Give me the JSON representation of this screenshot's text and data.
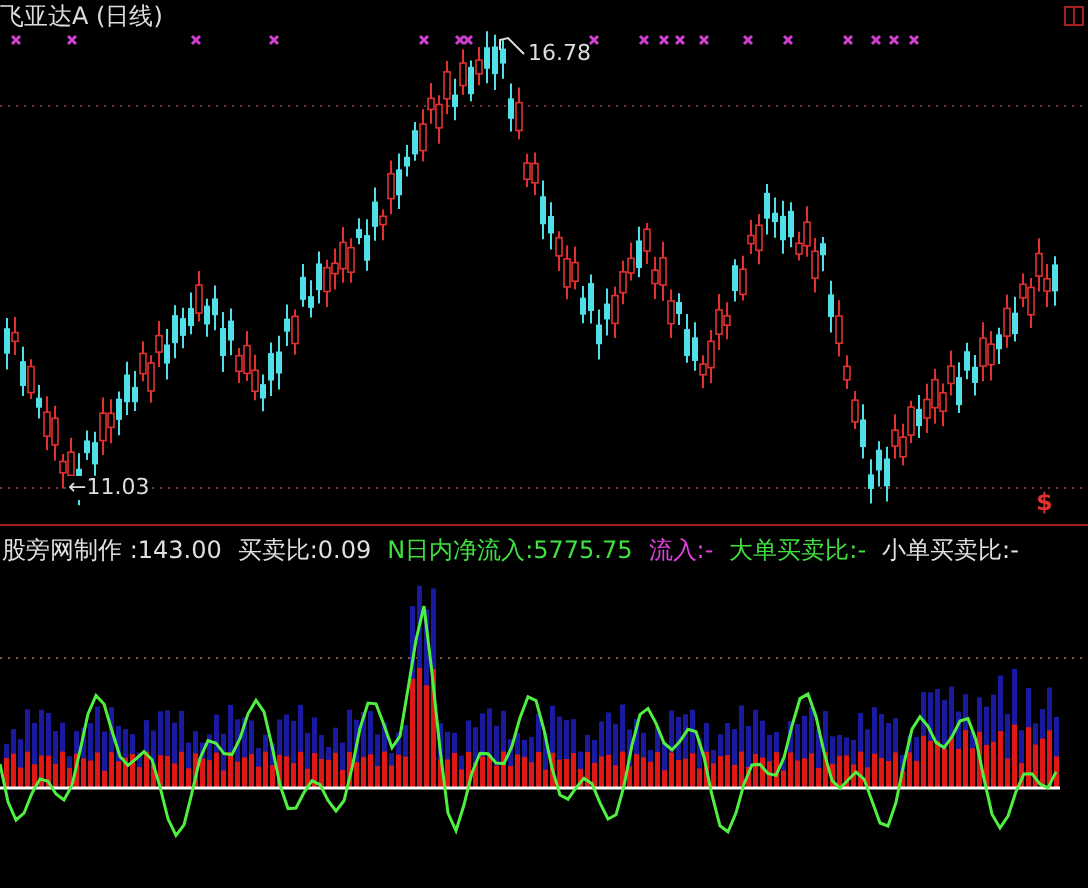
{
  "chart": {
    "title": "飞亚达A (日线)",
    "high_label": "16.78",
    "low_label": "←11.03",
    "signal_mark": "$"
  },
  "legend": [
    {
      "text": "股旁网制作 :143.00",
      "color": "#e0e0e0"
    },
    {
      "text": "买卖比:0.09",
      "color": "#e0e0e0"
    },
    {
      "text": "N日内净流入:5775.75",
      "color": "#40e040"
    },
    {
      "text": "流入:-",
      "color": "#e040e0"
    },
    {
      "text": "大单买卖比:-",
      "color": "#40e040"
    },
    {
      "text": "小单买卖比:-",
      "color": "#e0e0e0"
    }
  ]
}
